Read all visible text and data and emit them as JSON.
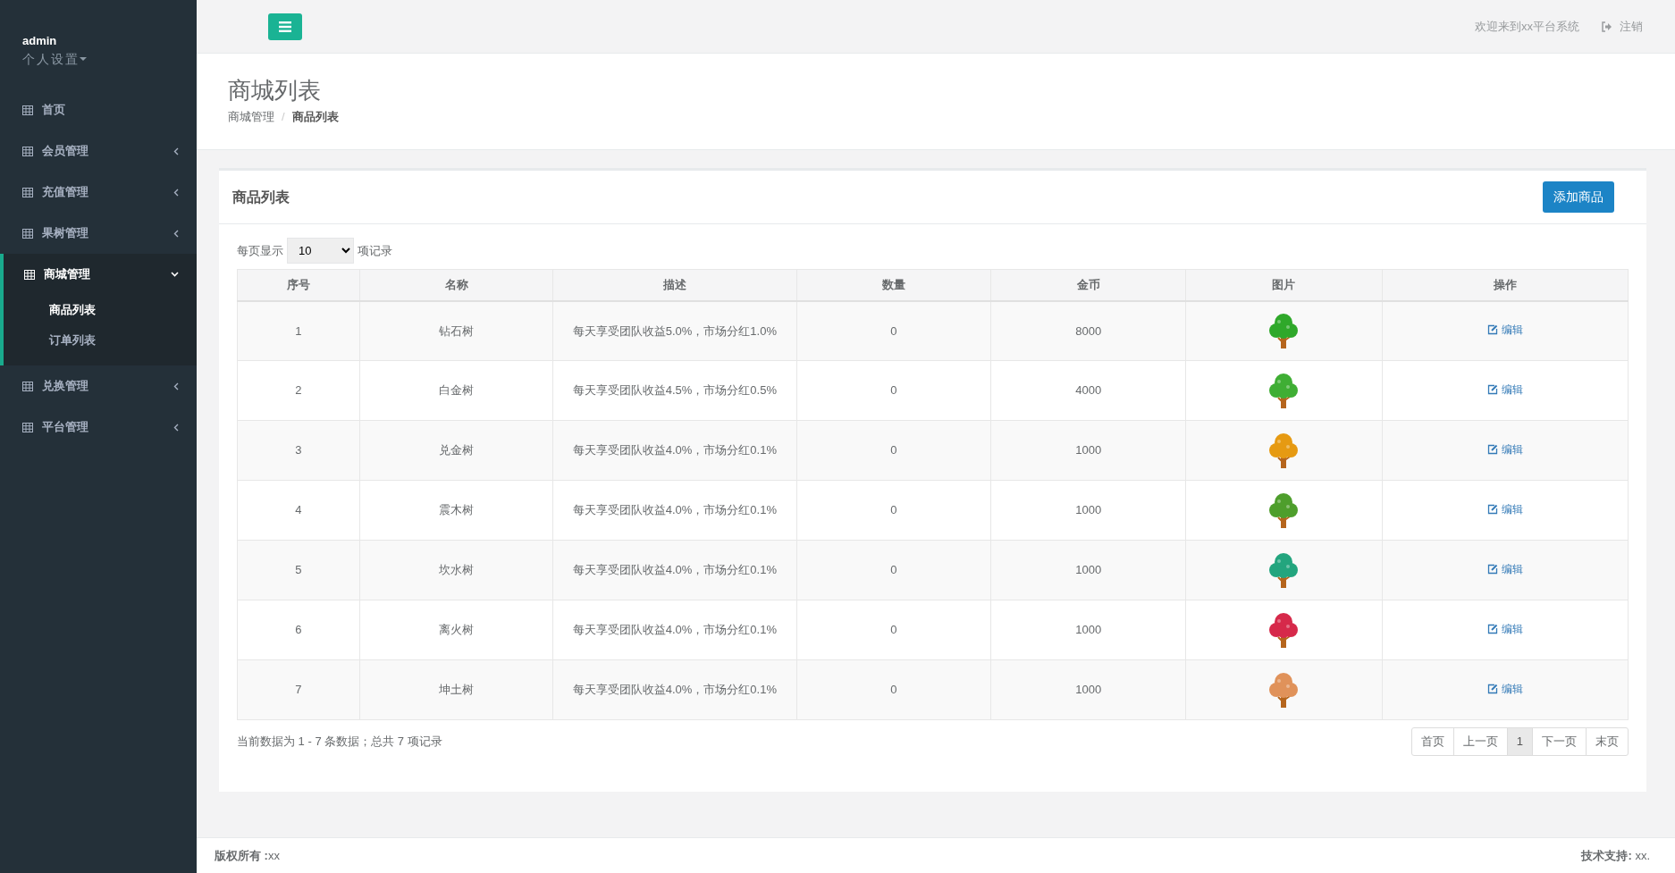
{
  "sidebar": {
    "user": {
      "name": "admin",
      "settings": "个人设置"
    },
    "items": [
      {
        "label": "首页",
        "selected": false
      },
      {
        "label": "会员管理",
        "selected": false,
        "expanded": false
      },
      {
        "label": "充值管理",
        "selected": false,
        "expanded": false
      },
      {
        "label": "果树管理",
        "selected": false,
        "expanded": false
      },
      {
        "label": "商城管理",
        "selected": true,
        "expanded": true,
        "children": [
          {
            "label": "商品列表",
            "selected": true
          },
          {
            "label": "订单列表",
            "selected": false
          }
        ]
      },
      {
        "label": "兑换管理",
        "selected": false,
        "expanded": false
      },
      {
        "label": "平台管理",
        "selected": false,
        "expanded": false
      }
    ]
  },
  "topbar": {
    "welcome": "欢迎来到xx平台系统",
    "logout": "注销"
  },
  "page_header": {
    "title": "商城列表",
    "breadcrumb_separator": "/",
    "breadcrumb": [
      {
        "label": "商城管理",
        "selected": false
      },
      {
        "label": "商品列表",
        "selected": true
      }
    ]
  },
  "panel": {
    "title": "商品列表",
    "add_button": "添加商品",
    "page_size": {
      "before": "每页显示",
      "value": "10",
      "after": "项记录"
    },
    "table": {
      "columns": [
        "序号",
        "名称",
        "描述",
        "数量",
        "金币",
        "图片",
        "操作"
      ],
      "rows": [
        {
          "index": "1",
          "name": "钻石树",
          "description": "每天享受团队收益5.0%，市场分红1.0%",
          "quantity": "0",
          "coins": "8000",
          "color": "#2fa82a",
          "action": "编辑"
        },
        {
          "index": "2",
          "name": "白金树",
          "description": "每天享受团队收益4.5%，市场分红0.5%",
          "quantity": "0",
          "coins": "4000",
          "color": "#3fae34",
          "action": "编辑"
        },
        {
          "index": "3",
          "name": "兑金树",
          "description": "每天享受团队收益4.0%，市场分红0.1%",
          "quantity": "0",
          "coins": "1000",
          "color": "#e69a12",
          "action": "编辑"
        },
        {
          "index": "4",
          "name": "震木树",
          "description": "每天享受团队收益4.0%，市场分红0.1%",
          "quantity": "0",
          "coins": "1000",
          "color": "#4e9e2c",
          "action": "编辑"
        },
        {
          "index": "5",
          "name": "坎水树",
          "description": "每天享受团队收益4.0%，市场分红0.1%",
          "quantity": "0",
          "coins": "1000",
          "color": "#23a57e",
          "action": "编辑"
        },
        {
          "index": "6",
          "name": "离火树",
          "description": "每天享受团队收益4.0%，市场分红0.1%",
          "quantity": "0",
          "coins": "1000",
          "color": "#d6294a",
          "action": "编辑"
        },
        {
          "index": "7",
          "name": "坤土树",
          "description": "每天享受团队收益4.0%，市场分红0.1%",
          "quantity": "0",
          "coins": "1000",
          "color": "#e0925a",
          "action": "编辑"
        }
      ]
    },
    "summary": "当前数据为 1 - 7 条数据；总共 7 项记录",
    "pagination": [
      {
        "label": "首页",
        "selected": false
      },
      {
        "label": "上一页",
        "selected": false
      },
      {
        "label": "1",
        "selected": true
      },
      {
        "label": "下一页",
        "selected": false
      },
      {
        "label": "末页",
        "selected": false
      }
    ]
  },
  "footer": {
    "copyright": "**版权所有 :**xx",
    "support": "**技术支持:** xx."
  }
}
